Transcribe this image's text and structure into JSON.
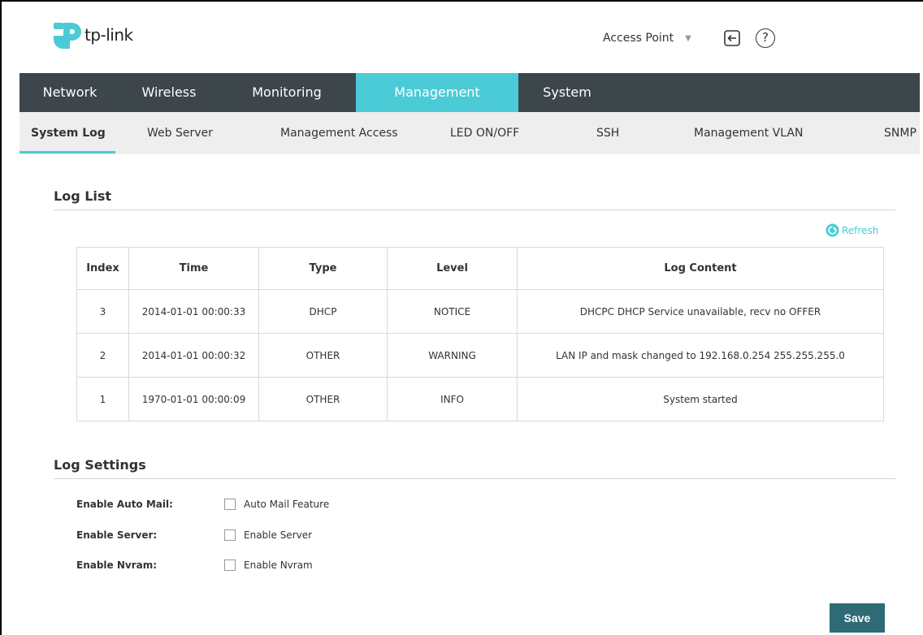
{
  "header": {
    "logo_text": "tp-link",
    "mode_select": "Access Point",
    "help_glyph": "?",
    "icons": [
      "tp-link-logo-icon",
      "logout-icon",
      "help-icon",
      "chevron-down-icon",
      "refresh-icon"
    ]
  },
  "colors": {
    "accent": "#4acbd6",
    "nav_bg": "#3c464b",
    "subnav_bg": "#eeeeee",
    "save_bg": "#2e6b76"
  },
  "main_nav": {
    "tabs": [
      {
        "label": "Network"
      },
      {
        "label": "Wireless"
      },
      {
        "label": "Monitoring"
      },
      {
        "label": "Management",
        "active": true
      },
      {
        "label": "System"
      }
    ]
  },
  "sub_nav": {
    "tabs": [
      {
        "label": "System Log",
        "active": true
      },
      {
        "label": "Web Server"
      },
      {
        "label": "Management Access"
      },
      {
        "label": "LED ON/OFF"
      },
      {
        "label": "SSH"
      },
      {
        "label": "Management VLAN"
      },
      {
        "label": "SNMP"
      }
    ]
  },
  "log_list": {
    "title": "Log List",
    "refresh_label": "Refresh",
    "columns": [
      "Index",
      "Time",
      "Type",
      "Level",
      "Log Content"
    ],
    "rows": [
      [
        "3",
        "2014-01-01 00:00:33",
        "DHCP",
        "NOTICE",
        "DHCPC DHCP Service unavailable, recv no OFFER"
      ],
      [
        "2",
        "2014-01-01 00:00:32",
        "OTHER",
        "WARNING",
        "LAN IP and mask changed to 192.168.0.254 255.255.255.0"
      ],
      [
        "1",
        "1970-01-01 00:00:09",
        "OTHER",
        "INFO",
        "System started"
      ]
    ]
  },
  "log_settings": {
    "title": "Log Settings",
    "auto_mail_label": "Enable Auto Mail:",
    "auto_mail_option": "Auto Mail Feature",
    "server_label": "Enable Server:",
    "server_option": "Enable Server",
    "nvram_label": "Enable Nvram:",
    "nvram_option": "Enable Nvram"
  },
  "save_label": "Save"
}
